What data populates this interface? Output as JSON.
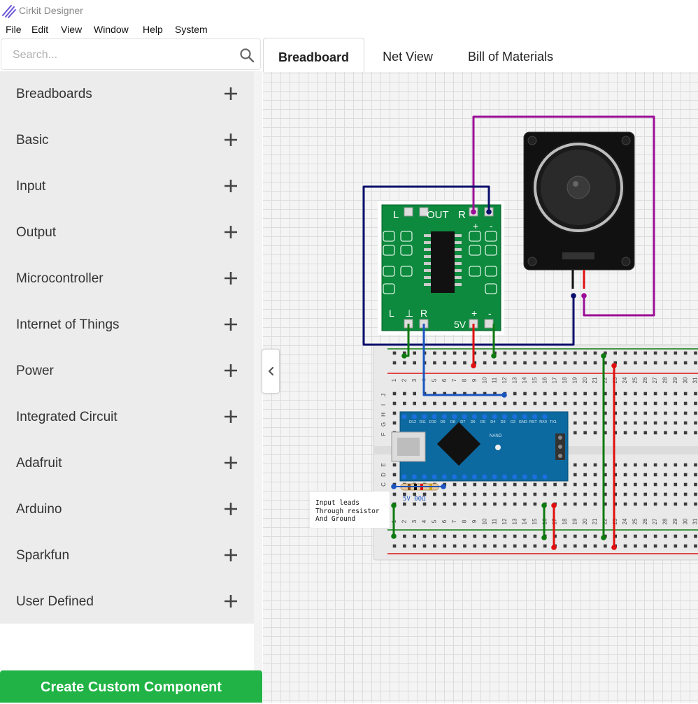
{
  "app": {
    "title": "Cirkit Designer",
    "logo_icon": "cirkit-logo-icon"
  },
  "menu": [
    "File",
    "Edit",
    "View",
    "Window",
    "Help",
    "System"
  ],
  "search": {
    "placeholder": "Search...",
    "icon": "search-icon"
  },
  "categories": [
    "Breadboards",
    "Basic",
    "Input",
    "Output",
    "Microcontroller",
    "Internet of Things",
    "Power",
    "Integrated Circuit",
    "Adafruit",
    "Arduino",
    "Sparkfun",
    "User Defined"
  ],
  "create_button": {
    "label": "Create Custom Component",
    "color": "#21b345"
  },
  "tabs": [
    {
      "label": "Breadboard",
      "active": true
    },
    {
      "label": "Net View",
      "active": false
    },
    {
      "label": "Bill of Materials",
      "active": false
    }
  ],
  "canvas": {
    "amplifier": {
      "pin_labels": [
        "L",
        "OUT",
        "R",
        "+",
        "-",
        "L",
        "⊥",
        "R",
        "5V",
        "+",
        "-"
      ]
    },
    "breadboard": {
      "top_numbers": [
        "1",
        "2",
        "3",
        "4",
        "5",
        "6",
        "7",
        "8",
        "9",
        "10",
        "11",
        "12",
        "13",
        "14",
        "15",
        "16",
        "17",
        "18",
        "19",
        "20",
        "21",
        "22",
        "23",
        "24",
        "25",
        "26",
        "27",
        "28",
        "29",
        "30",
        "31"
      ],
      "row_letters": [
        "J",
        "I",
        "H",
        "G",
        "F",
        "E",
        "D",
        "C",
        "B",
        "A"
      ]
    },
    "arduino": {
      "label": "NANO",
      "top_pins": [
        "D12",
        "D11",
        "D10",
        "D9",
        "D8",
        "D7",
        "D6",
        "D5",
        "D4",
        "D3",
        "D2",
        "GND",
        "RST",
        "RX0",
        "TX1"
      ]
    },
    "resistor": {
      "label": "5V 00Ω"
    },
    "note_lines": [
      "Input leads",
      "Through resistor",
      "And Ground"
    ],
    "wire_colors": {
      "purple": "#9b0e96",
      "navy": "#0a0f6b",
      "green": "#0e7a10",
      "red": "#e01010",
      "blue": "#1c55c0"
    }
  }
}
